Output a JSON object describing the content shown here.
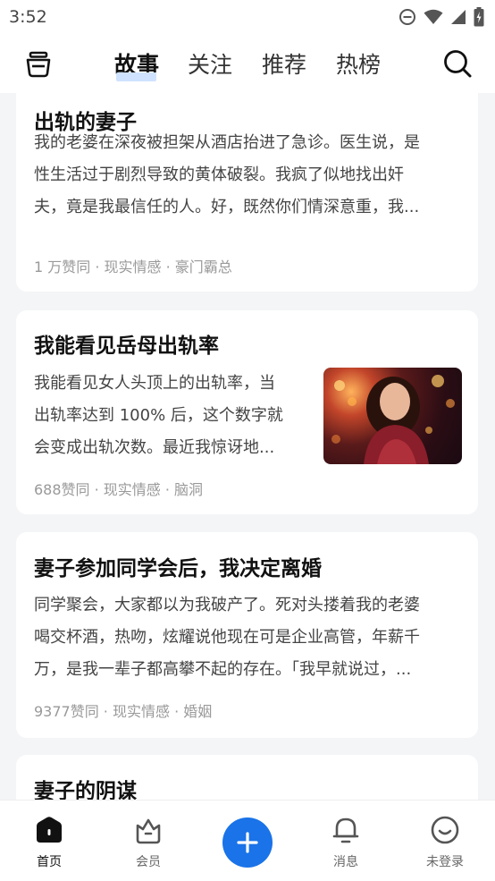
{
  "status_bar": {
    "time": "3:52"
  },
  "top_nav": {
    "tabs": [
      {
        "label": "故事",
        "active": true
      },
      {
        "label": "关注",
        "active": false
      },
      {
        "label": "推荐",
        "active": false
      },
      {
        "label": "热榜",
        "active": false
      }
    ]
  },
  "feed": {
    "cards": [
      {
        "title": "出轨的妻子",
        "excerpt_lines": [
          "我的老婆在深夜被担架从酒店抬进了急诊。医生说，是",
          "性生活过于剧烈导致的黄体破裂。我疯了似地找出奸",
          "夫，竟是我最信任的人。好，既然你们情深意重，我..."
        ],
        "meta": "1 万赞同 · 现实情感 · 豪门霸总"
      },
      {
        "title": "我能看见岳母出轨率",
        "excerpt_lines": [
          "我能看见女人头顶上的出轨率，当",
          "出轨率达到 100% 后，这个数字就",
          "会变成出轨次数。最近我惊讶地..."
        ],
        "meta": "688赞同 · 现实情感 · 脑洞"
      },
      {
        "title": "妻子参加同学会后，我决定离婚",
        "excerpt_lines": [
          "同学聚会，大家都以为我破产了。死对头搂着我的老婆",
          "喝交杯酒，热吻，炫耀说他现在可是企业高管，年薪千",
          "万，是我一辈子都高攀不起的存在。「我早就说过，..."
        ],
        "meta": "9377赞同 · 现实情感 · 婚姻"
      },
      {
        "title": "妻子的阴谋"
      }
    ]
  },
  "bottom_nav": {
    "items": [
      {
        "label": "首页",
        "icon": "home-icon",
        "active": true
      },
      {
        "label": "会员",
        "icon": "vip-icon",
        "active": false
      },
      {
        "label": "消息",
        "icon": "bell-icon",
        "active": false
      },
      {
        "label": "未登录",
        "icon": "user-icon",
        "active": false
      }
    ],
    "add_icon": "plus-icon"
  },
  "colors": {
    "accent": "#1a73e8",
    "background": "#f4f5f7",
    "tab_underline": "#cfe2ff"
  }
}
